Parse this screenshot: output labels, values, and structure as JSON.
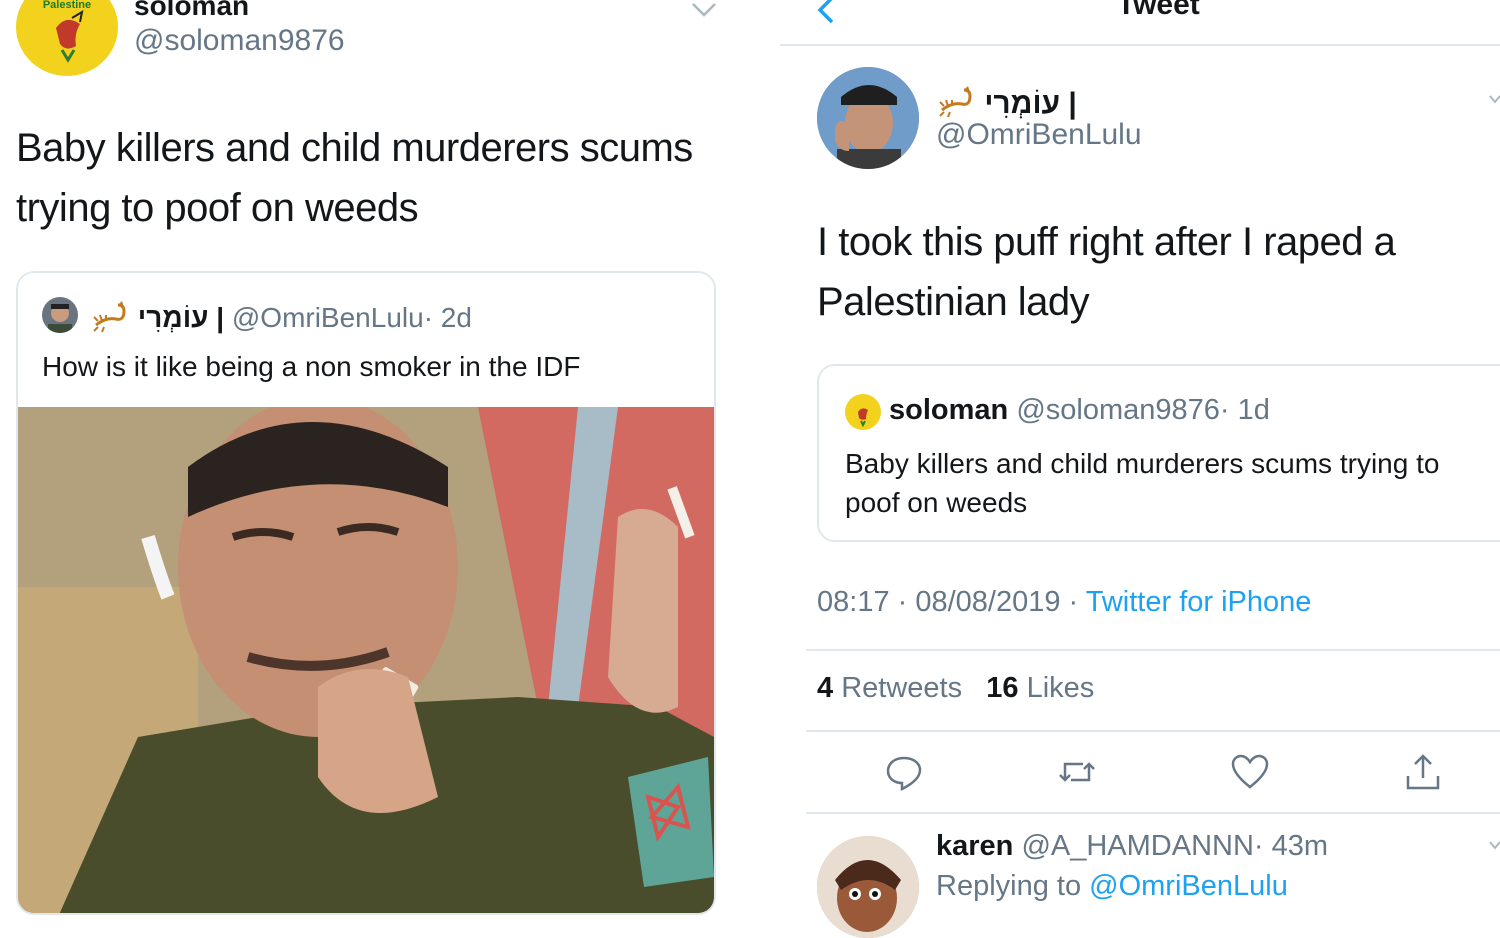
{
  "left_tweet": {
    "name": "soloman",
    "handle": "@soloman9876",
    "avatar_text": "Palestine",
    "text": "Baby killers and child murderers scums trying to poof on weeds",
    "quote": {
      "name": "עוֹמְרִי |",
      "handle": "@OmriBenLulu",
      "time": "· 2d",
      "text": "How is it like being a non smoker in the IDF",
      "media": "soldier-smoking-photo"
    }
  },
  "right_tweet": {
    "header_title": "Tweet",
    "name": "עוֹמְרִי |",
    "handle": "@OmriBenLulu",
    "text": "I took this puff right after I raped a Palestinian lady",
    "quote": {
      "name": "soloman",
      "handle": "@soloman9876",
      "time": "· 1d",
      "text": "Baby killers and child murderers scums trying to poof on weeds"
    },
    "timestamp": "08:17 · 08/08/2019 ·",
    "source": "Twitter for iPhone",
    "retweets_count": "4",
    "retweets_label": "Retweets",
    "likes_count": "16",
    "likes_label": "Likes"
  },
  "reply": {
    "name": "karen",
    "handle": "@A_HAMDANNN",
    "time": "· 43m",
    "replying_prefix": "Replying to",
    "replying_handle": "@OmriBenLulu"
  },
  "colors": {
    "link": "#1da1f2",
    "muted": "#657786",
    "divider": "#e1e8ed",
    "avatar_yellow": "#f2d21c"
  },
  "icons": [
    "chevron-down-icon",
    "back-chevron-icon",
    "scorpion-icon",
    "reply-icon",
    "retweet-icon",
    "like-icon",
    "share-icon"
  ]
}
